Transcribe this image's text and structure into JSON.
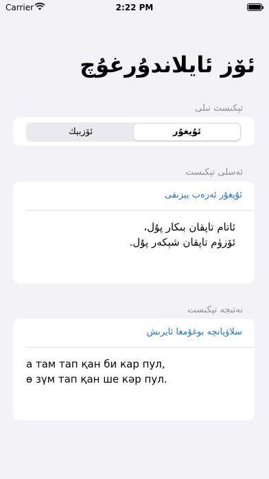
{
  "status_bar": {
    "carrier": "Carrier",
    "time": "2:22 PM",
    "icons": [
      "wifi-icon",
      "battery-icon"
    ]
  },
  "page_title": "ئۆز ئايلاندۇرغۇچ",
  "script_section": {
    "label": "تېكىست تىلى",
    "segments": [
      {
        "label": "ئۇيغۇر",
        "selected": true
      },
      {
        "label": "ئۆزبېك",
        "selected": false
      }
    ]
  },
  "source_section": {
    "label": "ئەسلى تېكىست",
    "link": "ئۇيغۇر ئەرەب يېزىقى",
    "lines": [
      "ئاتام تاپقان بىكار پۇل،",
      "ئۆزۈم تاپقان شېكەر پۇل."
    ]
  },
  "result_section": {
    "label": "نەتىجە تېكىست",
    "link": "سلاۋيانچە بوغۇمغا ئايرىش",
    "lines": [
      "а там тап қан би кар пул,",
      "ө зүм тап қан ше кәр пул."
    ]
  },
  "colors": {
    "background": "#f2f2f7",
    "accent": "#1a73e8",
    "secondary_text": "#8e8e93"
  }
}
